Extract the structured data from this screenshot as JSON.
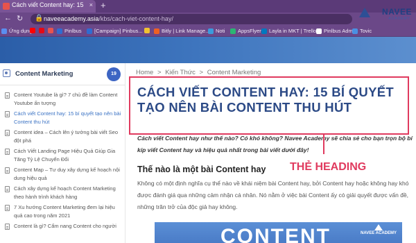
{
  "browser": {
    "tab_title": "Cách viết Content hay: 15 bí quyế",
    "tab_close": "×",
    "new_tab": "+",
    "url_domain": "naveeacademy.asia",
    "url_path": "/kbs/cach-viet-content-hay/",
    "bookmarks": [
      {
        "label": "Ứng dụng",
        "color": "#5b8ef0"
      },
      {
        "label": "",
        "color": "#ff0000"
      },
      {
        "label": "",
        "color": "#e50914"
      },
      {
        "label": "",
        "color": "#e8534d"
      },
      {
        "label": "Pinlbus",
        "color": "#2f6cd1"
      },
      {
        "label": "[Campaign] Pinbus...",
        "color": "#2f6cd1"
      },
      {
        "label": "",
        "color": "#f1c232"
      },
      {
        "label": "Bitly | Link Manage...",
        "color": "#ee6123"
      },
      {
        "label": "Noti",
        "color": "#3a9bdc"
      },
      {
        "label": "AppsFlyer",
        "color": "#2bb673"
      },
      {
        "label": "Layla in MKT | Trello",
        "color": "#0079bf"
      },
      {
        "label": "Pinlbus Admin",
        "color": "#ffffff"
      },
      {
        "label": "Tovic",
        "color": "#4a90e2"
      }
    ]
  },
  "brand": {
    "name": "NAVEE",
    "sub": "ACADEMY"
  },
  "sidebar": {
    "title": "Content Marketing",
    "count": "19",
    "items": [
      "Content Youtube là gì? 7 chủ đề làm Content Youtube ấn tượng",
      "Cách viết Content hay: 15 bí quyết tạo nên bài Content thu hút",
      "Content idea – Cách lên ý tưởng bài viết Seo đột phá",
      "Cách Viết Landing Page Hiệu Quả Giúp Gia Tăng Tỷ Lệ Chuyển Đổi",
      "Content Map – Tư duy xây dựng kế hoạch nội dung hiệu quả",
      "Cách xây dựng kế hoạch Content Marketing theo hành trình khách hàng",
      "7 Xu hướng Content Marketing đem lại hiệu quả cao trong năm 2021",
      "Content là gì? Cẩm nang Content cho người"
    ]
  },
  "breadcrumb": [
    "Home",
    ">",
    "Kiến Thức",
    ">",
    "Content Marketing"
  ],
  "article": {
    "title": "CÁCH VIẾT CONTENT HAY: 15 BÍ QUYẾT TẠO NÊN BÀI CONTENT THU HÚT",
    "intro": "Cách viết Content hay như thế nào? Có khó không? Navee Academy sẽ chia sẻ cho bạn trọn bộ bí kíp viết Content hay và hiệu quả nhất trong bài viết dưới đây!",
    "h2": "Thế nào là một bài Content hay",
    "paragraph": "Không có một định nghĩa cụ thể nào về khái niệm bài Content hay, bởi Content hay hoặc không hay khó được đánh giá qua những cảm nhận cá nhân. Nó nằm ở việc bài Content ấy có giải quyết được vấn đề, những trăn trở của độc giả hay không.",
    "banner_text": "CONTENT",
    "banner_logo": "NAVEE ACADEMY"
  },
  "annotation": {
    "callout": "THẺ HEADING",
    "color": "#e03a5e"
  }
}
